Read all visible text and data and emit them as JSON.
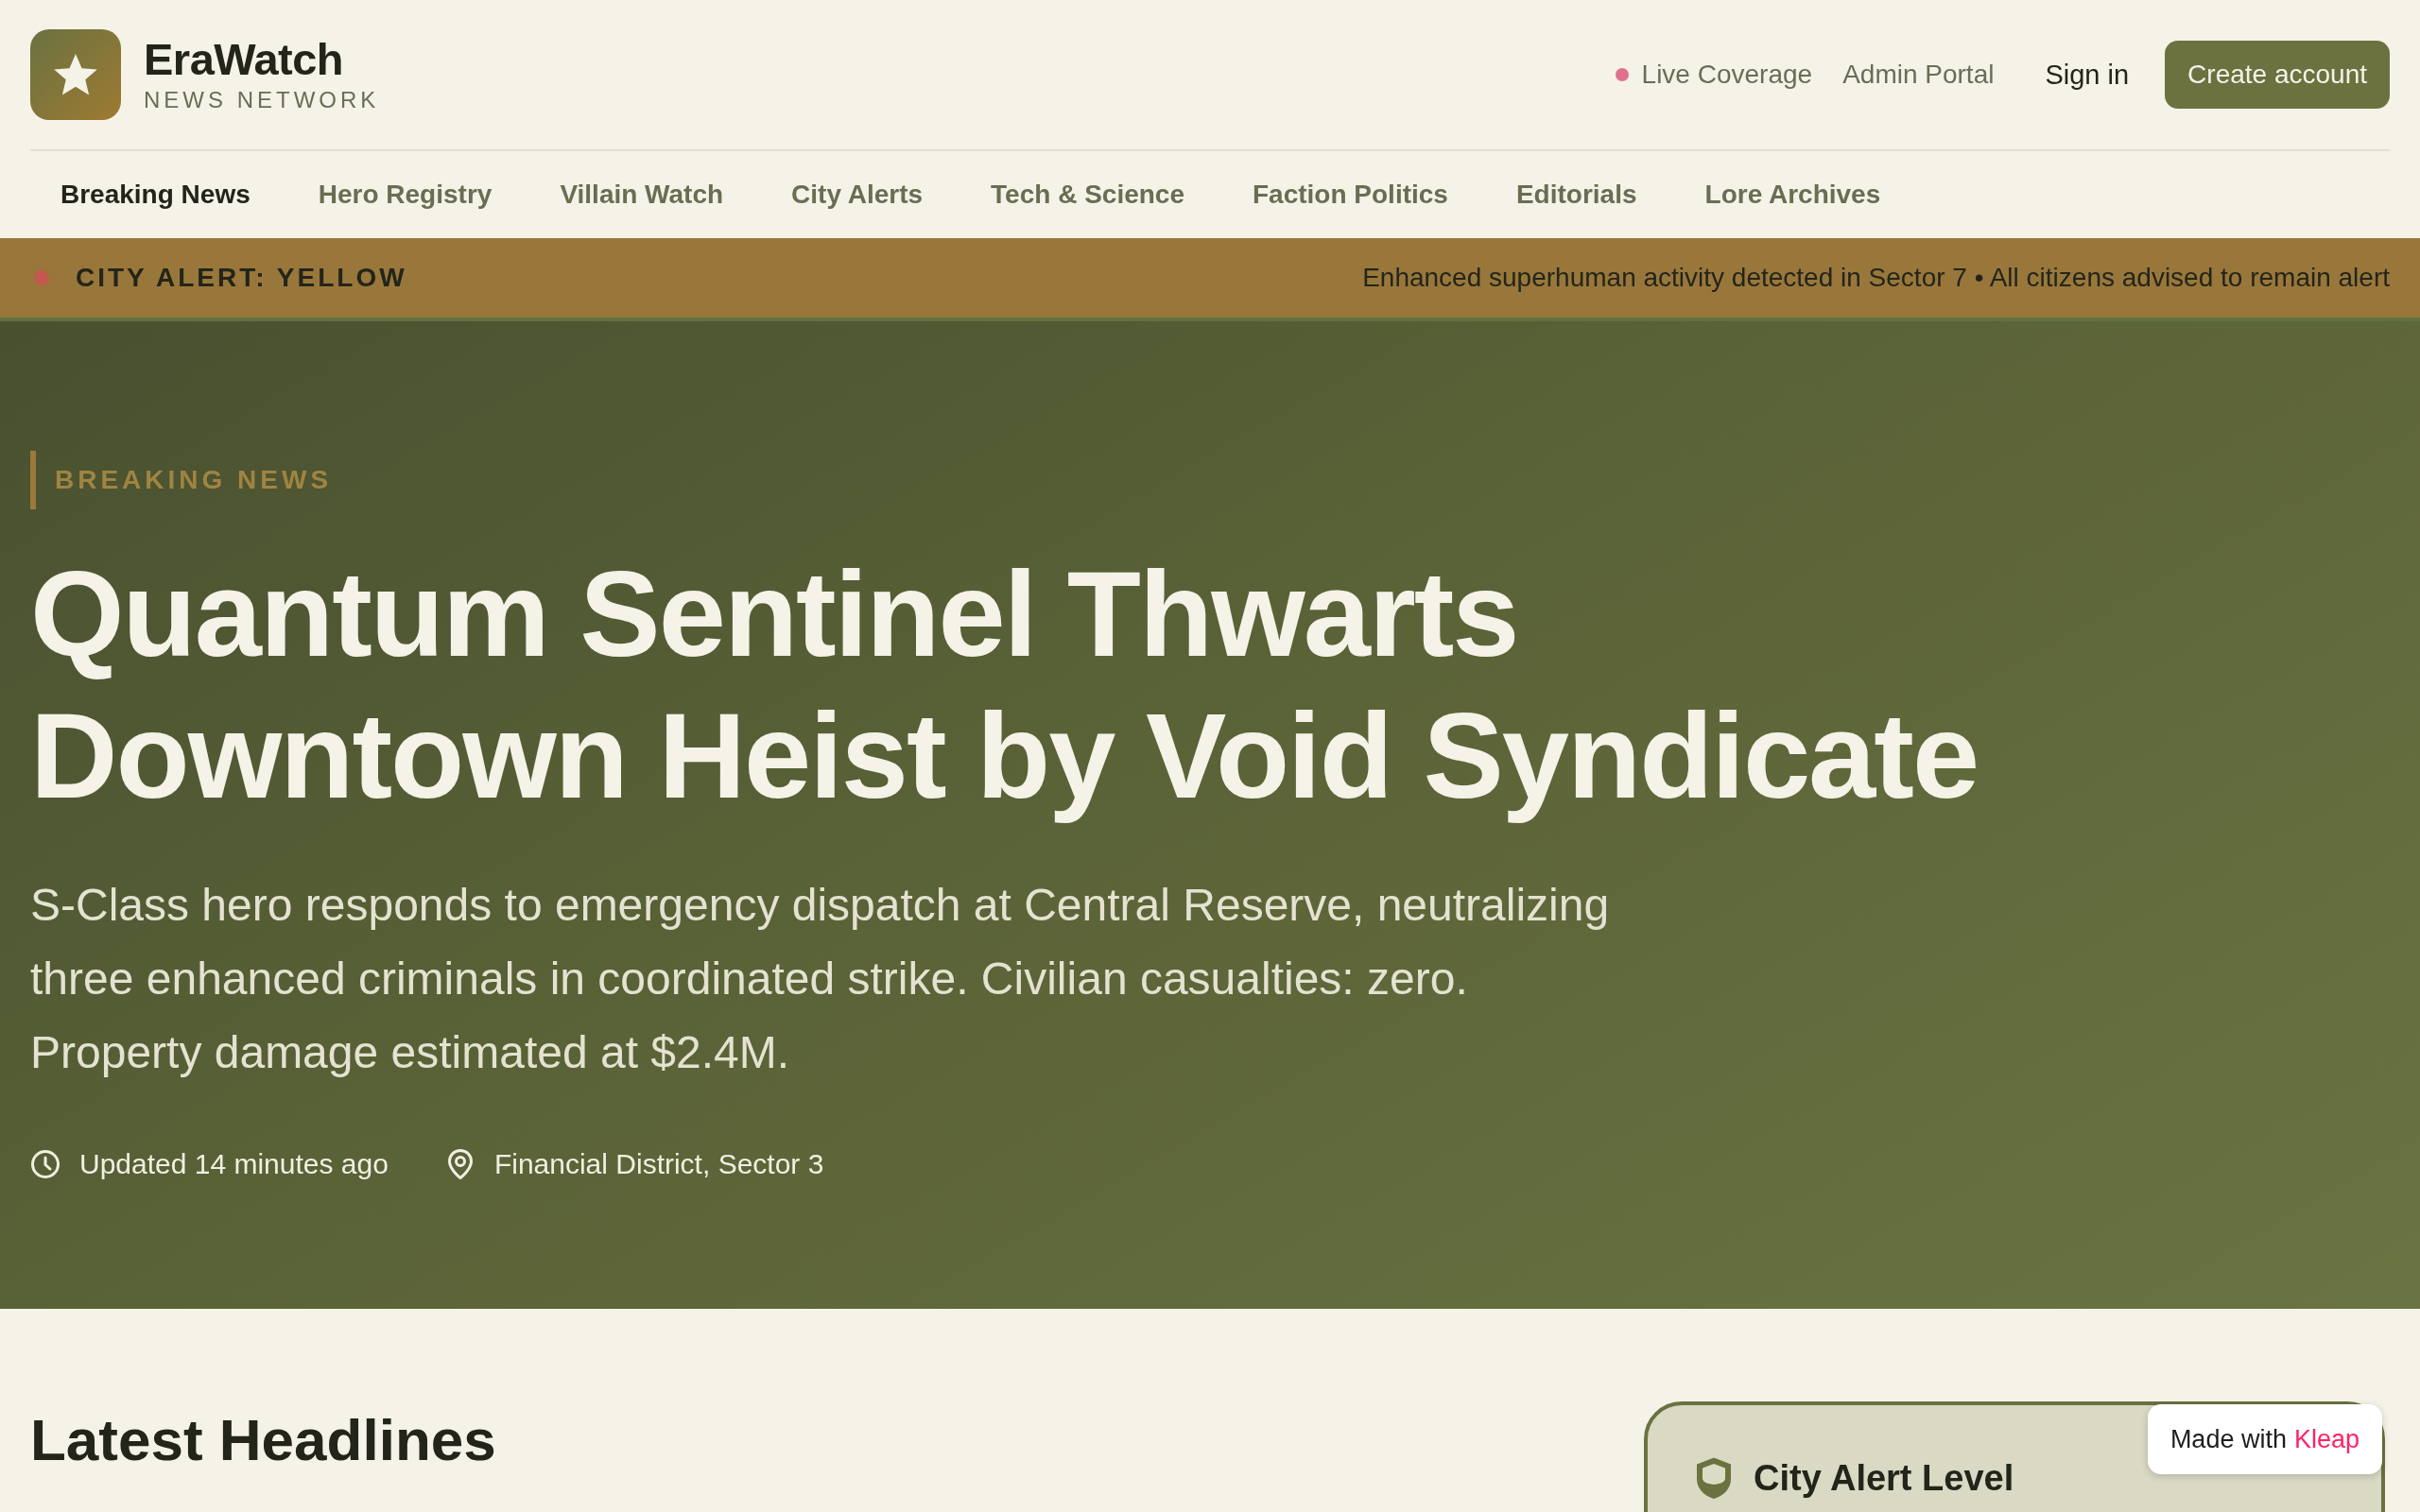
{
  "header": {
    "brand": {
      "name": "EraWatch",
      "tagline": "NEWS NETWORK"
    },
    "links": [
      {
        "label": "Live Coverage",
        "kind": "live"
      },
      {
        "label": "Admin Portal",
        "kind": "plain"
      }
    ],
    "sign_in": "Sign in",
    "create_account": "Create account"
  },
  "nav": [
    {
      "label": "Breaking News",
      "selected": true
    },
    {
      "label": "Hero Registry",
      "selected": false
    },
    {
      "label": "Villain Watch",
      "selected": false
    },
    {
      "label": "City Alerts",
      "selected": false
    },
    {
      "label": "Tech & Science",
      "selected": false
    },
    {
      "label": "Faction Politics",
      "selected": false
    },
    {
      "label": "Editorials",
      "selected": false
    },
    {
      "label": "Lore Archives",
      "selected": false
    }
  ],
  "alert_bar": {
    "label": "CITY ALERT: YELLOW",
    "message": "Enhanced superhuman activity detected in Sector 7 • All citizens advised to remain alert"
  },
  "hero": {
    "eyebrow": "BREAKING NEWS",
    "title": "Quantum Sentinel Thwarts Downtown Heist by Void Syndicate",
    "lede": "S-Class hero responds to emergency dispatch at Central Reserve, neutralizing three enhanced criminals in coordinated strike. Civilian casualties: zero. Property damage estimated at $2.4M.",
    "meta": [
      {
        "kind": "time",
        "text": "Updated 14 minutes ago"
      },
      {
        "kind": "location",
        "text": "Financial District, Sector 3"
      }
    ]
  },
  "latest": {
    "title": "Latest Headlines"
  },
  "alert_card": {
    "title": "City Alert Level"
  },
  "builder_badge": {
    "text": "Made with",
    "brand": "Kleap"
  }
}
